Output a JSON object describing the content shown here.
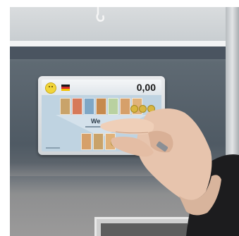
{
  "kiosk_screen": {
    "amount": "0,00",
    "welcome_text": "We",
    "icons": [
      "smiley-icon",
      "german-flag-icon"
    ],
    "banknote_colors": [
      "#c9a36a",
      "#d67a5a",
      "#7fa7c6",
      "#c68a4e",
      "#b9d1a0",
      "#d6a06a",
      "#e0b27a"
    ],
    "flag_colors": [
      "#1a1a1a",
      "#d62b2b",
      "#f2c100"
    ]
  }
}
